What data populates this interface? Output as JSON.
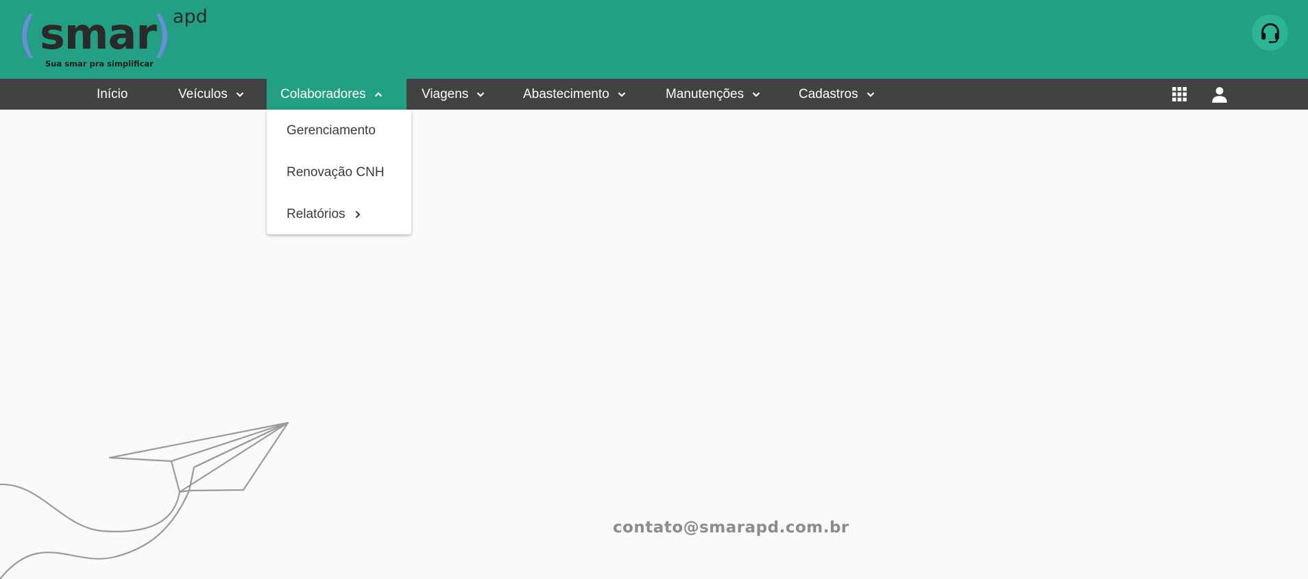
{
  "brand": {
    "paren_left": "(",
    "word": "smar",
    "paren_right": ")",
    "sup": "apd",
    "tagline": "Sua smar pra simplificar",
    "colors": {
      "header": "#23a083",
      "navbar": "#424242",
      "paren": "#6a8fd8",
      "support_button": "#2cb594"
    }
  },
  "header": {
    "support_icon": "headset-icon"
  },
  "nav": {
    "items": [
      {
        "label": "Início",
        "has_dropdown": false
      },
      {
        "label": "Veículos",
        "has_dropdown": true
      },
      {
        "label": "Colaboradores",
        "has_dropdown": true,
        "active": true
      },
      {
        "label": "Viagens",
        "has_dropdown": true
      },
      {
        "label": "Abastecimento",
        "has_dropdown": true
      },
      {
        "label": "Manutenções",
        "has_dropdown": true
      },
      {
        "label": "Cadastros",
        "has_dropdown": true
      }
    ],
    "right_icons": [
      "apps-grid-icon",
      "user-icon"
    ]
  },
  "dropdown": {
    "items": [
      {
        "label": "Gerenciamento"
      },
      {
        "label": "Renovação CNH"
      },
      {
        "label": "Relatórios",
        "has_submenu": true
      }
    ]
  },
  "footer": {
    "contact_email": "contato@smarapd.com.br"
  }
}
